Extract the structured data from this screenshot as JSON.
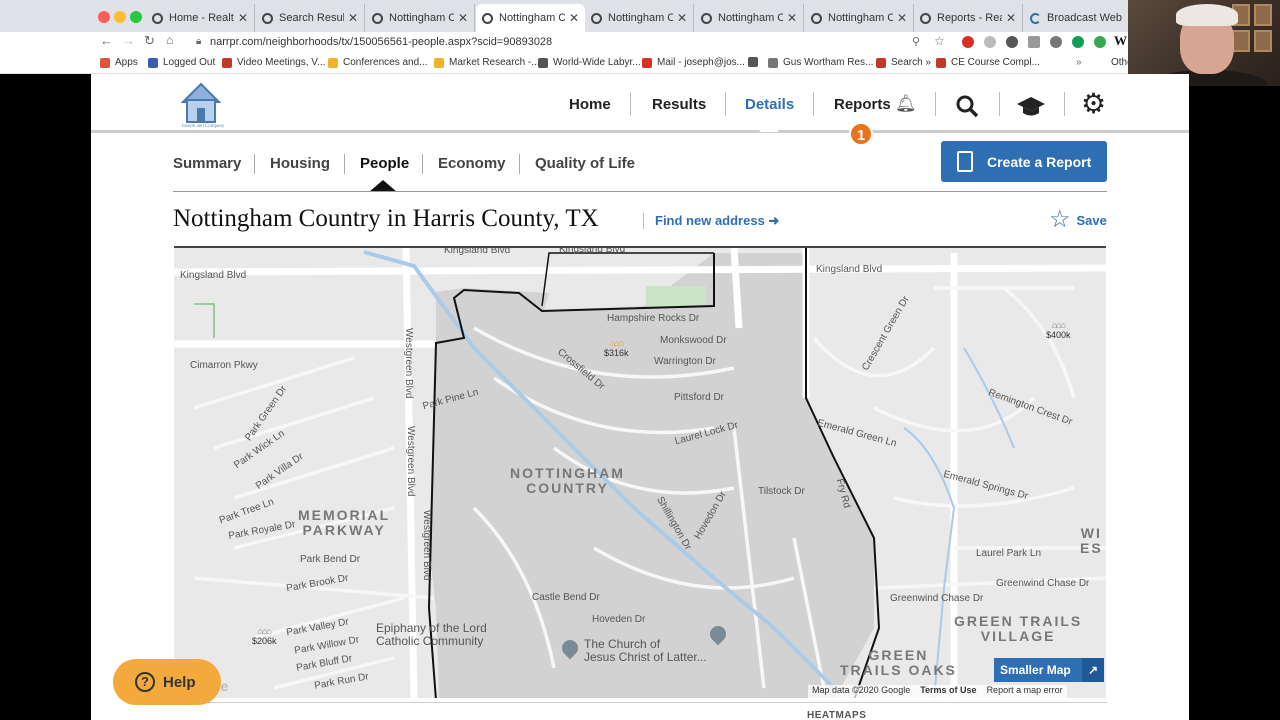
{
  "browser": {
    "tabs": [
      {
        "title": "Home - Realtors"
      },
      {
        "title": "Search Results f"
      },
      {
        "title": "Nottingham Cou"
      },
      {
        "title": "Nottingham Cou"
      },
      {
        "title": "Nottingham Cou"
      },
      {
        "title": "Nottingham Cou"
      },
      {
        "title": "Nottingham Cou"
      },
      {
        "title": "Reports - Realto"
      },
      {
        "title": "Broadcast Webi"
      }
    ],
    "url": "narrpr.com/neighborhoods/tx/150056561-people.aspx?scid=90893028",
    "bookmarks": [
      {
        "label": "Apps",
        "color": "#e0543b"
      },
      {
        "label": "Logged Out",
        "color": "#3a5bb0"
      },
      {
        "label": "Video Meetings, V...",
        "color": "#c0392b"
      },
      {
        "label": "Conferences and...",
        "color": "#f0b429"
      },
      {
        "label": "Market Research -...",
        "color": "#f0b429"
      },
      {
        "label": "World-Wide Labyr...",
        "color": "#555555"
      },
      {
        "label": "Mail - joseph@jos...",
        "color": "#d93025"
      },
      {
        "label": "",
        "color": "#555555"
      },
      {
        "label": "Gus Wortham Res...",
        "color": "#777777"
      },
      {
        "label": "Search »",
        "color": "#c0392b"
      },
      {
        "label": "CE Course Compl...",
        "color": "#c0392b"
      },
      {
        "label": "Othe",
        "color": "#888888"
      }
    ]
  },
  "nav": {
    "home": "Home",
    "results": "Results",
    "details": "Details",
    "reports": "Reports",
    "reports_badge": "1"
  },
  "subnav": {
    "summary": "Summary",
    "housing": "Housing",
    "people": "People",
    "economy": "Economy",
    "quality": "Quality of Life"
  },
  "header": {
    "create_report": "Create a Report",
    "title": "Nottingham Country in Harris County, TX",
    "find_address": "Find new address ➜",
    "save": "Save"
  },
  "map": {
    "streets": [
      {
        "name": "Kingsland Blvd",
        "id": "kingsland-w"
      },
      {
        "name": "Kingsland Blvd",
        "id": "kingsland-n"
      },
      {
        "name": "Kingsland Blvd",
        "id": "kingsland-e"
      },
      {
        "name": "Cimarron Pkwy",
        "id": "cimarron"
      },
      {
        "name": "Westgreen Blvd",
        "id": "westgreen-1"
      },
      {
        "name": "Westgreen Blvd",
        "id": "westgreen-2"
      },
      {
        "name": "Westgreen Blvd",
        "id": "westgreen-3"
      },
      {
        "name": "Hampshire Rocks Dr",
        "id": "hampshire"
      },
      {
        "name": "Monkswood Dr",
        "id": "monkswood"
      },
      {
        "name": "Warrington Dr",
        "id": "warrington"
      },
      {
        "name": "Crossfield Dr",
        "id": "crossfield"
      },
      {
        "name": "Pittsford Dr",
        "id": "pittsford"
      },
      {
        "name": "Laurel Lock Dr",
        "id": "laurel-lock"
      },
      {
        "name": "Park Pine Ln",
        "id": "park-pine"
      },
      {
        "name": "Park Green Dr",
        "id": "park-green"
      },
      {
        "name": "Park Wick Ln",
        "id": "park-wick"
      },
      {
        "name": "Park Villa Dr",
        "id": "park-villa"
      },
      {
        "name": "Park Tree Ln",
        "id": "park-tree"
      },
      {
        "name": "Park Royale Dr",
        "id": "park-royale"
      },
      {
        "name": "Park Bend Dr",
        "id": "park-bend"
      },
      {
        "name": "Park Brook Dr",
        "id": "park-brook"
      },
      {
        "name": "Park Valley Dr",
        "id": "park-valley"
      },
      {
        "name": "Park Willow Dr",
        "id": "park-willow"
      },
      {
        "name": "Park Bluff Dr",
        "id": "park-bluff"
      },
      {
        "name": "Park Run Dr",
        "id": "park-run"
      },
      {
        "name": "Tilstock Dr",
        "id": "tilstock"
      },
      {
        "name": "Shillington Dr",
        "id": "shillington"
      },
      {
        "name": "Hovedon Dr",
        "id": "hovedon"
      },
      {
        "name": "Castle Bend Dr",
        "id": "castle-bend"
      },
      {
        "name": "Hoveden Dr",
        "id": "hoveden"
      },
      {
        "name": "Emerald Green Ln",
        "id": "emerald-green"
      },
      {
        "name": "Emerald Springs Dr",
        "id": "emerald-springs"
      },
      {
        "name": "Laurel Park Ln",
        "id": "laurel-park"
      },
      {
        "name": "Greenwind Chase Dr",
        "id": "greenwind-1"
      },
      {
        "name": "Greenwind Chase Dr",
        "id": "greenwind-2"
      },
      {
        "name": "Crescent Green Dr",
        "id": "crescent"
      },
      {
        "name": "Remington Crest Dr",
        "id": "remington"
      },
      {
        "name": "Fry Rd",
        "id": "fry"
      }
    ],
    "areas": [
      {
        "name": "NOTTINGHAM\nCOUNTRY",
        "id": "nottingham"
      },
      {
        "name": "MEMORIAL\nPARKWAY",
        "id": "memorial"
      },
      {
        "name": "GREEN TRAILS\nVILLAGE",
        "id": "green-trails-village"
      },
      {
        "name": "GREEN\nTRAILS OAKS",
        "id": "green-trails-oaks"
      },
      {
        "name": "WI\nES",
        "id": "west-edge"
      }
    ],
    "prices": [
      {
        "value": "$316k",
        "id": "price-316"
      },
      {
        "value": "$400k",
        "id": "price-400"
      },
      {
        "value": "$206k",
        "id": "price-206"
      }
    ],
    "pois": [
      {
        "name": "Epiphany of the Lord\nCatholic Community",
        "id": "epiphany"
      },
      {
        "name": "The Church of\nJesus Christ of Latter...",
        "id": "lds"
      }
    ],
    "smaller_map": "Smaller Map",
    "attribution": {
      "data": "Map data ©2020 Google",
      "terms": "Terms of Use",
      "report": "Report a map error"
    },
    "watermark": "gle"
  },
  "section": {
    "heatmaps": "HEATMAPS"
  },
  "help": {
    "label": "Help"
  },
  "colors": {
    "accent": "#2e6fb4",
    "badge": "#e8731b",
    "help": "#f3a93c"
  }
}
